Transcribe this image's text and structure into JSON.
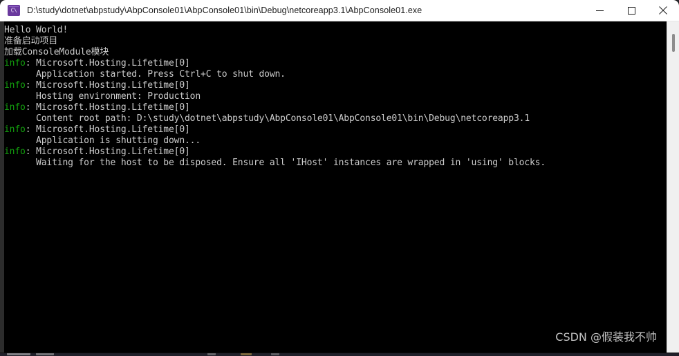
{
  "window": {
    "title": "D:\\study\\dotnet\\abpstudy\\AbpConsole01\\AbpConsole01\\bin\\Debug\\netcoreapp3.1\\AbpConsole01.exe",
    "icon_name": "console-app-icon",
    "icon_glyph": "C\\",
    "icon_color": "#6a399e",
    "titlebar_bg": "#ffffff",
    "titlebar_fg": "#1b1b1b",
    "controls": {
      "minimize_label": "Minimize",
      "maximize_label": "Maximize",
      "close_label": "Close"
    }
  },
  "console": {
    "background": "#000000",
    "foreground": "#cccccc",
    "info_color": "#13a10e",
    "lines": [
      {
        "segments": [
          {
            "text": "Hello World!",
            "style": "plain"
          }
        ]
      },
      {
        "segments": [
          {
            "text": "准备启动项目",
            "style": "plain"
          }
        ]
      },
      {
        "segments": [
          {
            "text": "加载ConsoleModule模块",
            "style": "plain"
          }
        ]
      },
      {
        "segments": [
          {
            "text": "info",
            "style": "info"
          },
          {
            "text": ": Microsoft.Hosting.Lifetime[0]",
            "style": "plain"
          }
        ]
      },
      {
        "segments": [
          {
            "text": "      Application started. Press Ctrl+C to shut down.",
            "style": "plain"
          }
        ]
      },
      {
        "segments": [
          {
            "text": "info",
            "style": "info"
          },
          {
            "text": ": Microsoft.Hosting.Lifetime[0]",
            "style": "plain"
          }
        ]
      },
      {
        "segments": [
          {
            "text": "      Hosting environment: Production",
            "style": "plain"
          }
        ]
      },
      {
        "segments": [
          {
            "text": "info",
            "style": "info"
          },
          {
            "text": ": Microsoft.Hosting.Lifetime[0]",
            "style": "plain"
          }
        ]
      },
      {
        "segments": [
          {
            "text": "      Content root path: D:\\study\\dotnet\\abpstudy\\AbpConsole01\\AbpConsole01\\bin\\Debug\\netcoreapp3.1",
            "style": "plain"
          }
        ]
      },
      {
        "segments": [
          {
            "text": "info",
            "style": "info"
          },
          {
            "text": ": Microsoft.Hosting.Lifetime[0]",
            "style": "plain"
          }
        ]
      },
      {
        "segments": [
          {
            "text": "      Application is shutting down...",
            "style": "plain"
          }
        ]
      },
      {
        "segments": [
          {
            "text": "info",
            "style": "info"
          },
          {
            "text": ": Microsoft.Hosting.Lifetime[0]",
            "style": "plain"
          }
        ]
      },
      {
        "segments": [
          {
            "text": "      Waiting for the host to be disposed. Ensure all 'IHost' instances are wrapped in 'using' blocks.",
            "style": "plain"
          }
        ]
      }
    ]
  },
  "scrollbar": {
    "track_color": "#f0f0f0",
    "thumb_color": "#8d8d8d"
  },
  "watermark": {
    "text": "CSDN @假装我不帅"
  }
}
